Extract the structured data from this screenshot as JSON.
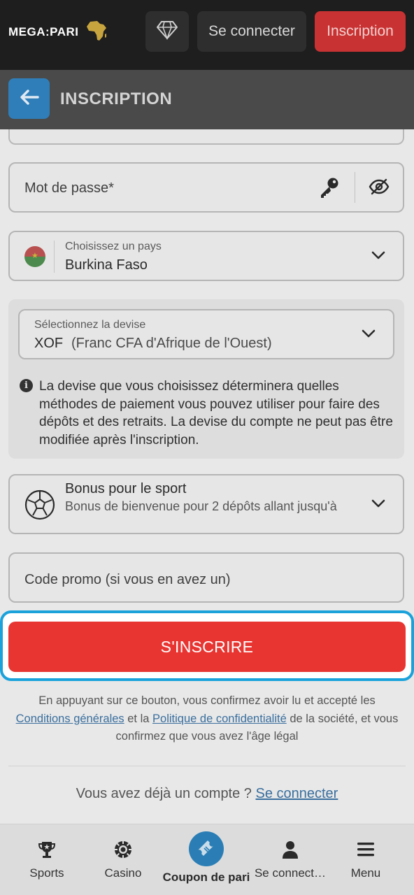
{
  "header": {
    "logo_text": "MEGA:PARI",
    "login_label": "Se connecter",
    "signup_label": "Inscription"
  },
  "subheader": {
    "title": "INSCRIPTION"
  },
  "form": {
    "password_placeholder": "Mot de passe*",
    "country_label": "Choisissez un pays",
    "country_value": "Burkina Faso",
    "currency_label": "Sélectionnez la devise",
    "currency_code": "XOF",
    "currency_name": "(Franc CFA d'Afrique de l'Ouest)",
    "currency_info": "La devise que vous choisissez déterminera quelles méthodes de paiement vous pouvez utiliser pour faire des dépôts et des retraits. La devise du compte ne peut pas être modifiée après l'inscription.",
    "bonus_title": "Bonus pour le sport",
    "bonus_subtitle": "Bonus de bienvenue pour 2 dépôts allant jusqu'à",
    "promo_placeholder": "Code promo (si vous en avez un)",
    "submit_label": "S'INSCRIRE"
  },
  "terms": {
    "part1": "En appuyant sur ce bouton, vous confirmez avoir lu et accepté les ",
    "link_conditions": "Conditions générales",
    "part2": " et la ",
    "link_privacy": "Politique de confidentialité",
    "part3": " de la société, et vous confirmez que vous avez l'âge légal"
  },
  "account": {
    "question": "Vous avez déjà un compte ? ",
    "login_link": "Se connecter"
  },
  "bottom_nav": {
    "items": [
      {
        "label": "Sports",
        "icon": "trophy-icon"
      },
      {
        "label": "Casino",
        "icon": "casino-chip-icon"
      },
      {
        "label": "Coupon de pari",
        "icon": "ticket-icon"
      },
      {
        "label": "Se connect…",
        "icon": "user-icon"
      },
      {
        "label": "Menu",
        "icon": "hamburger-icon"
      }
    ]
  },
  "colors": {
    "accent_red": "#e83531",
    "accent_blue": "#2f7eb9",
    "focus_border": "#1ba2db"
  }
}
